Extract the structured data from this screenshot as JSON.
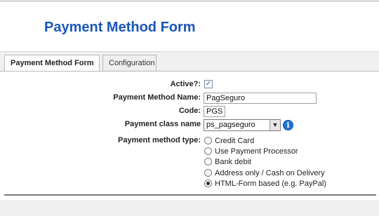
{
  "page_title": "Payment Method Form",
  "tabs": [
    {
      "label": "Payment Method Form",
      "active": true
    },
    {
      "label": "Configuration",
      "active": false
    }
  ],
  "form": {
    "active": {
      "label": "Active?:",
      "checked": true
    },
    "name": {
      "label": "Payment Method Name:",
      "value": "PagSeguro"
    },
    "code": {
      "label": "Code:",
      "value": "PGS"
    },
    "class_name": {
      "label": "Payment class name",
      "value": "ps_pagseguro"
    },
    "type": {
      "label": "Payment method type:",
      "options": [
        {
          "label": "Credit Card",
          "checked": false
        },
        {
          "label": "Use Payment Processor",
          "checked": false
        },
        {
          "label": "Bank debit",
          "checked": false
        },
        {
          "label": "Address only / Cash on Delivery",
          "checked": false
        },
        {
          "label": "HTML-Form based (e.g. PayPal)",
          "checked": true
        }
      ]
    }
  },
  "icons": {
    "info": "info-icon",
    "select_arrow": "chevron-down-icon",
    "checkbox_mark": "check-icon"
  },
  "colors": {
    "title": "#1a56b8",
    "info_icon": "#1d73d8"
  }
}
